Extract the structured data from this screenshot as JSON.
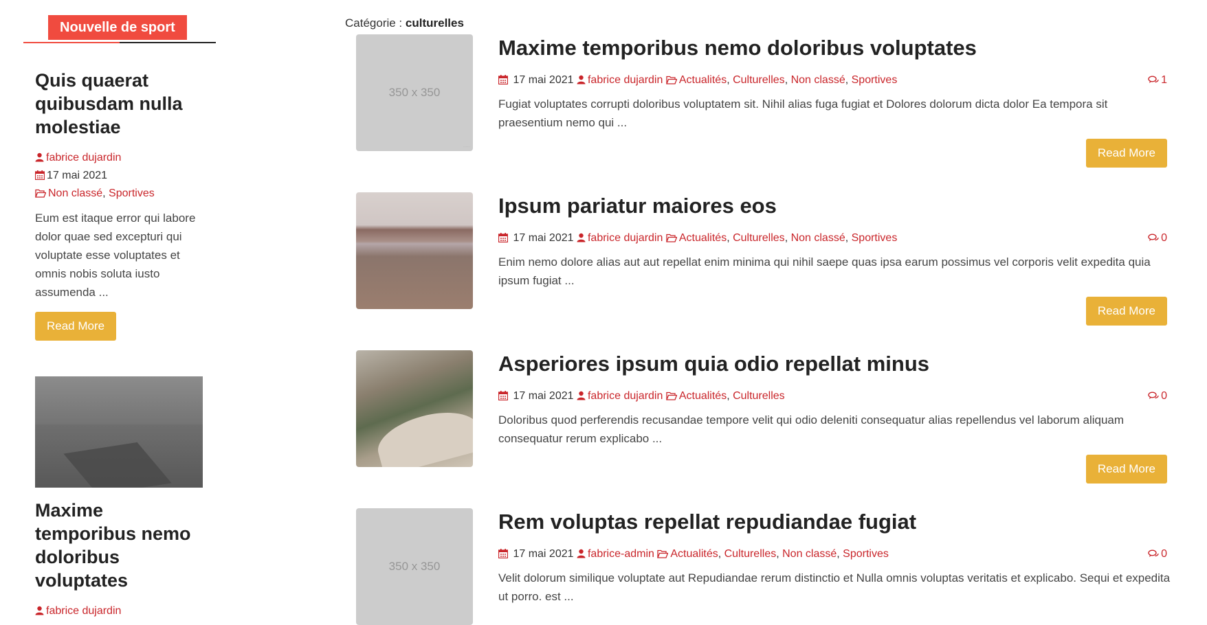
{
  "sidebar": {
    "widget_title": "Nouvelle de sport",
    "posts": [
      {
        "title": "Quis quaerat quibusdam nulla molestiae",
        "author": "fabrice dujardin",
        "date": "17 mai 2021",
        "categories": [
          "Non classé",
          "Sportives"
        ],
        "excerpt": "Eum est itaque error qui labore dolor quae sed excepturi qui voluptate esse voluptates et omnis nobis soluta iusto assumenda ...",
        "read_more": "Read More"
      },
      {
        "title": "Maxime temporibus nemo doloribus voluptates",
        "author": "fabrice dujardin"
      }
    ]
  },
  "main": {
    "category_label": "Catégorie :",
    "category_name": "culturelles",
    "posts": [
      {
        "thumb_text": "350 x 350",
        "title": "Maxime temporibus nemo doloribus voluptates",
        "date": "17 mai 2021",
        "author": "fabrice dujardin",
        "categories": [
          "Actualités",
          "Culturelles",
          "Non classé",
          "Sportives"
        ],
        "comments": "1",
        "excerpt": "Fugiat voluptates corrupti doloribus voluptatem sit. Nihil alias fuga fugiat et Dolores dolorum dicta dolor Ea tempora sit praesentium nemo qui ...",
        "read_more": "Read More"
      },
      {
        "title": "Ipsum pariatur maiores eos",
        "date": "17 mai 2021",
        "author": "fabrice dujardin",
        "categories": [
          "Actualités",
          "Culturelles",
          "Non classé",
          "Sportives"
        ],
        "comments": "0",
        "excerpt": "Enim nemo dolore alias aut aut repellat enim minima qui nihil saepe quas ipsa earum possimus vel corporis velit expedita quia ipsum fugiat ...",
        "read_more": "Read More"
      },
      {
        "title": "Asperiores ipsum quia odio repellat minus",
        "date": "17 mai 2021",
        "author": "fabrice dujardin",
        "categories": [
          "Actualités",
          "Culturelles"
        ],
        "comments": "0",
        "excerpt": "Doloribus quod perferendis recusandae tempore velit qui odio deleniti consequatur alias repellendus vel laborum aliquam consequatur rerum explicabo ...",
        "read_more": "Read More"
      },
      {
        "thumb_text": "350 x 350",
        "title": "Rem voluptas repellat repudiandae fugiat",
        "date": "17 mai 2021",
        "author": "fabrice-admin",
        "categories": [
          "Actualités",
          "Culturelles",
          "Non classé",
          "Sportives"
        ],
        "comments": "0",
        "excerpt": "Velit dolorum similique voluptate aut Repudiandae rerum distinctio et Nulla omnis voluptas veritatis et explicabo. Sequi et expedita ut porro. est ..."
      }
    ]
  },
  "colors": {
    "accent_red": "#f04b3f",
    "link_red": "#c9252a",
    "button_yellow": "#e9b138"
  },
  "icons": {
    "calendar": "calendar-icon",
    "user": "user-icon",
    "folder": "folder-open-icon",
    "comments": "comments-icon"
  }
}
